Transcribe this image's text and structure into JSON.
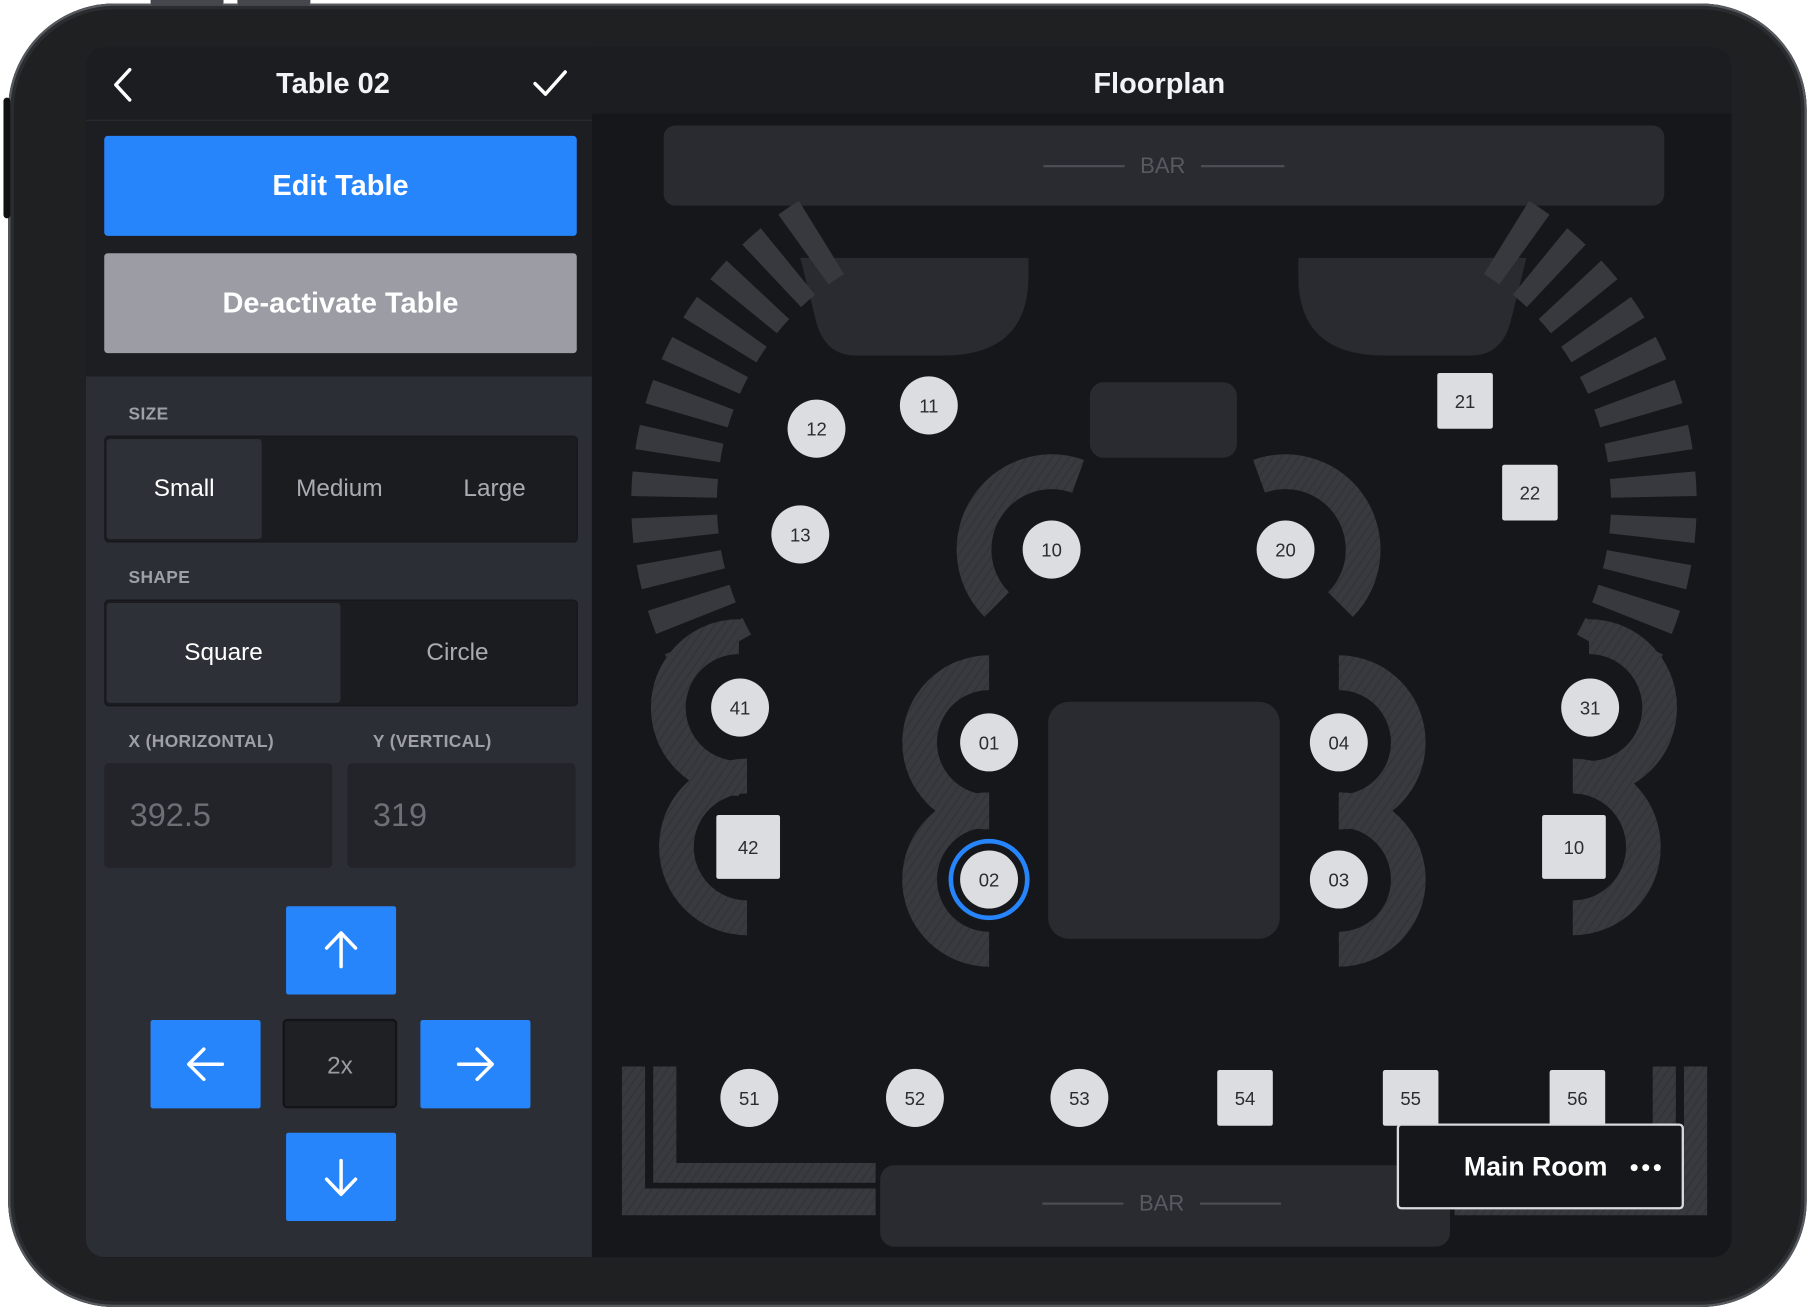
{
  "sidebar": {
    "title": "Table 02",
    "edit_button": "Edit Table",
    "deactivate_button": "De-activate Table",
    "size": {
      "label": "SIZE",
      "options": [
        "Small",
        "Medium",
        "Large"
      ],
      "selected": "Small"
    },
    "shape": {
      "label": "SHAPE",
      "options": [
        "Square",
        "Circle"
      ],
      "selected": "Square"
    },
    "x": {
      "label": "X (HORIZONTAL)",
      "value": "392.5"
    },
    "y": {
      "label": "Y (VERTICAL)",
      "value": "319"
    },
    "step": "2x"
  },
  "floorplan": {
    "title": "Floorplan",
    "bar_top_label": "BAR",
    "bar_bottom_label": "BAR",
    "room_name": "Main Room",
    "selected_table": "02",
    "tables": [
      {
        "label": "11",
        "shape": "circle"
      },
      {
        "label": "12",
        "shape": "circle"
      },
      {
        "label": "13",
        "shape": "circle"
      },
      {
        "label": "10",
        "shape": "circle"
      },
      {
        "label": "20",
        "shape": "circle"
      },
      {
        "label": "21",
        "shape": "square"
      },
      {
        "label": "22",
        "shape": "square"
      },
      {
        "label": "41",
        "shape": "circle"
      },
      {
        "label": "42",
        "shape": "square"
      },
      {
        "label": "01",
        "shape": "circle"
      },
      {
        "label": "02",
        "shape": "circle"
      },
      {
        "label": "04",
        "shape": "circle"
      },
      {
        "label": "03",
        "shape": "circle"
      },
      {
        "label": "31",
        "shape": "circle"
      },
      {
        "label": "10",
        "shape": "square"
      },
      {
        "label": "51",
        "shape": "circle"
      },
      {
        "label": "52",
        "shape": "circle"
      },
      {
        "label": "53",
        "shape": "circle"
      },
      {
        "label": "54",
        "shape": "square"
      },
      {
        "label": "55",
        "shape": "square"
      },
      {
        "label": "56",
        "shape": "square"
      }
    ]
  },
  "colors": {
    "accent": "#2785fc",
    "table_fill": "#dcdde1",
    "seat": "#38393e",
    "background": "#16171b"
  }
}
